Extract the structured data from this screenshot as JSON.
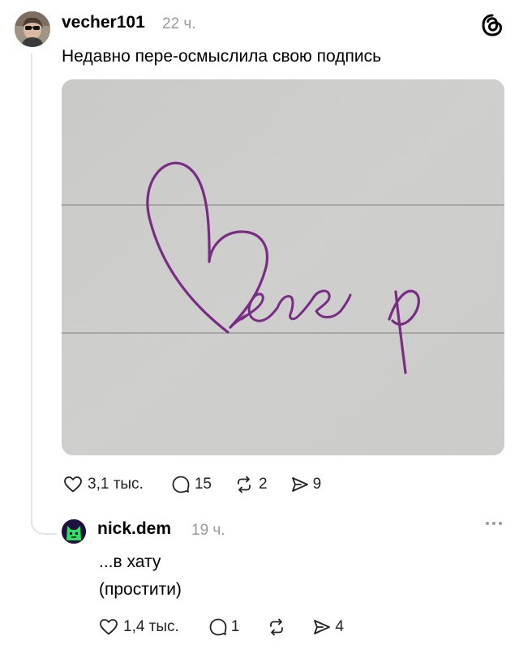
{
  "post": {
    "username": "vecher101",
    "time": "22 ч.",
    "text": "Недавно пере-осмыслила свою подпись",
    "image_icon": "signature-photo",
    "actions": {
      "likes": "3,1 тыс.",
      "comments": "15",
      "reposts": "2",
      "shares": "9"
    }
  },
  "reply": {
    "username": "nick.dem",
    "time": "19 ч.",
    "line1": "...в хату",
    "line2": "(простити)",
    "actions": {
      "likes": "1,4 тыс.",
      "comments": "1",
      "shares": "4"
    }
  },
  "colors": {
    "muted": "#999999",
    "thread_line": "#e3e3e3",
    "ink": "#7a2b86"
  }
}
